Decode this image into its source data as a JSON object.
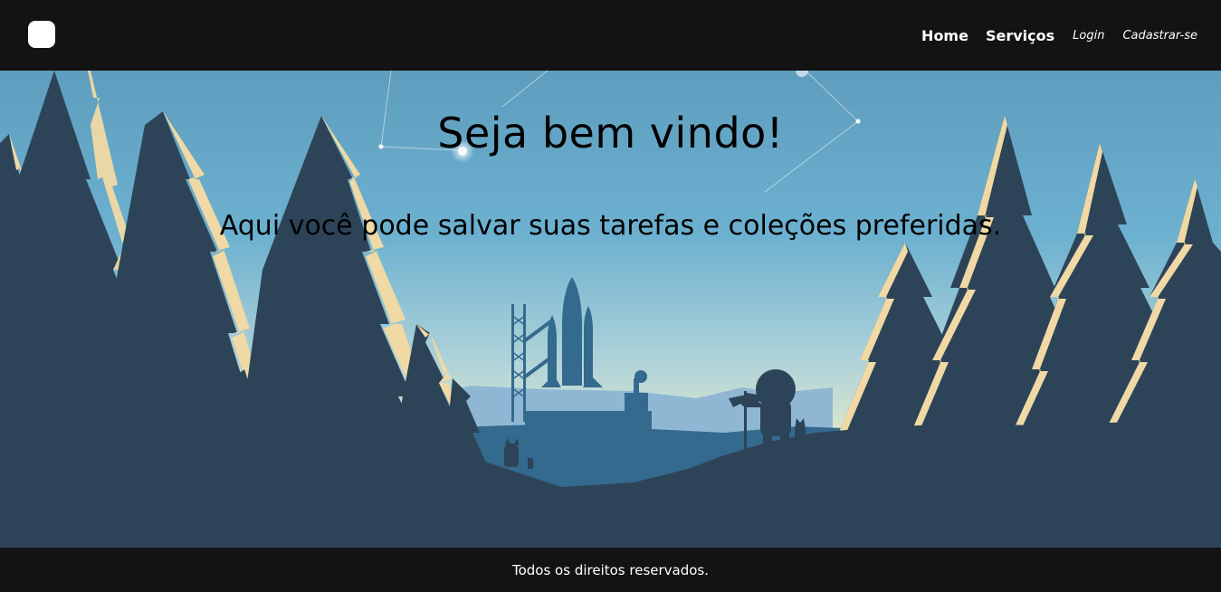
{
  "navbar": {
    "links": {
      "home": "Home",
      "servicos": "Serviços",
      "login": "Login",
      "cadastrar": "Cadastrar-se"
    }
  },
  "hero": {
    "title": "Seja bem vindo!",
    "subtitle": "Aqui você pode salvar suas tarefas e coleções preferidas."
  },
  "footer": {
    "text": "Todos os direitos reservados."
  },
  "colors": {
    "navbar_bg": "#131313",
    "sky_top": "#5e9dbd",
    "sky_bottom": "#e6ecc8",
    "tree": "#2d4458",
    "tree_highlight": "#f0d9a4",
    "midground": "#346a8e"
  }
}
